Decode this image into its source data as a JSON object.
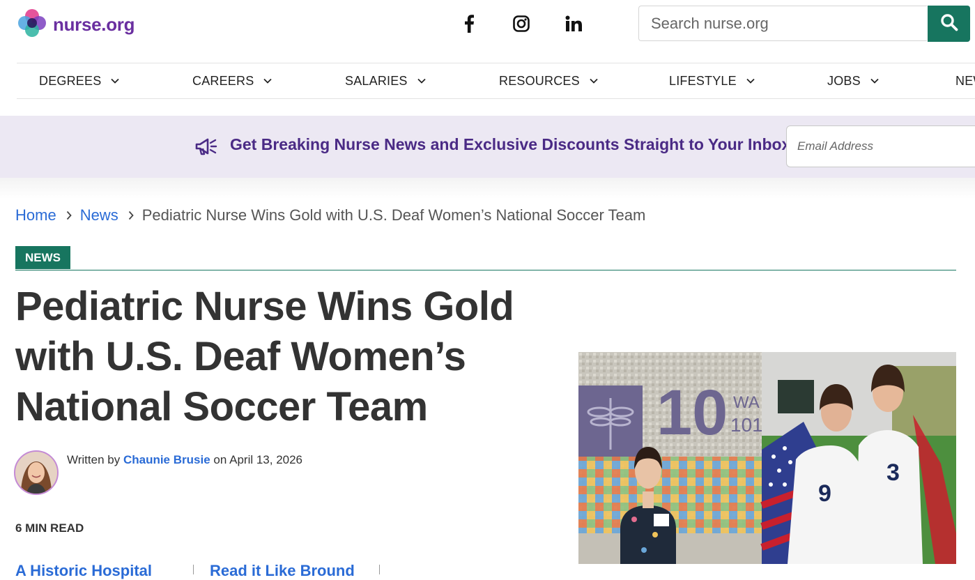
{
  "header": {
    "logo_text": "nurse.org",
    "social": [
      {
        "icon": "facebook-icon"
      },
      {
        "icon": "instagram-icon"
      },
      {
        "icon": "linkedin-icon"
      }
    ],
    "search": {
      "placeholder": "Search nurse.org",
      "button_icon": "search-icon"
    }
  },
  "nav": {
    "items": [
      {
        "label": "DEGREES"
      },
      {
        "label": "CAREERS"
      },
      {
        "label": "SALARIES"
      },
      {
        "label": "RESOURCES"
      },
      {
        "label": "LIFESTYLE"
      },
      {
        "label": "JOBS"
      },
      {
        "label": "NEWS"
      }
    ]
  },
  "newsletter": {
    "text": "Get Breaking Nurse News and Exclusive Discounts Straight to Your Inbox!",
    "email_placeholder": "Email Address",
    "icon": "megaphone-icon"
  },
  "breadcrumb": {
    "home": "Home",
    "section": "News",
    "current": "Pediatric Nurse Wins Gold with U.S. Deaf Women’s National Soccer Team"
  },
  "article": {
    "category": "NEWS",
    "title": "Pediatric Nurse Wins Gold with U.S. Deaf Women’s National Soccer Team",
    "byline_prefix": "Written by",
    "author": "Chaunie Brusie",
    "byline_on": "on",
    "date": "April 13, 2026",
    "read_time": "6 MIN READ",
    "hero_image": {
      "wall_number": "10",
      "jersey_left": "9",
      "jersey_right": "3"
    },
    "toc_links": [
      "A Historic Hospital",
      "Read it Like Bround"
    ]
  },
  "colors": {
    "brand_purple": "#6a2fa0",
    "brand_green": "#17755f",
    "link_blue": "#2a6bd6",
    "banner_bg": "#ece8f3",
    "banner_text": "#4a2a85"
  }
}
